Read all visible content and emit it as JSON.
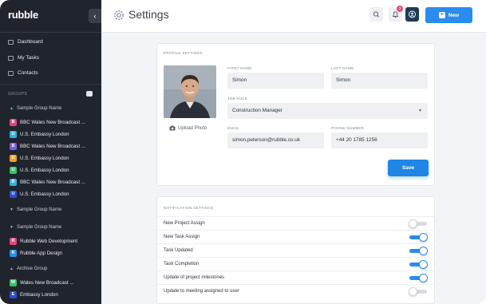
{
  "app": {
    "logo": "rubble",
    "collapse_glyph": "‹"
  },
  "nav": [
    {
      "label": "Dashboard"
    },
    {
      "label": "My Tasks"
    },
    {
      "label": "Contacts"
    }
  ],
  "groups": {
    "title": "GROUPS",
    "sections": [
      {
        "name": "Sample Group Name",
        "expanded": true,
        "items": [
          {
            "letter": "B",
            "color": "#e0457b",
            "label": "BBC Wales New Broadcast ..."
          },
          {
            "letter": "U",
            "color": "#2bb5e0",
            "label": "U.S. Embassy London"
          },
          {
            "letter": "B",
            "color": "#7b5be6",
            "label": "BBC Wales New Broadcast ..."
          },
          {
            "letter": "U",
            "color": "#f0a020",
            "label": "U.S. Embassy London"
          },
          {
            "letter": "U",
            "color": "#35c46a",
            "label": "U.S. Embassy London"
          },
          {
            "letter": "B",
            "color": "#2bb5e0",
            "label": "BBC Wales New Broadcast ..."
          },
          {
            "letter": "U",
            "color": "#2a4fd6",
            "label": "U.S. Embassy London"
          }
        ]
      },
      {
        "name": "Sample Group Name",
        "expanded": false,
        "items": []
      },
      {
        "name": "Sample Group Name",
        "expanded": false,
        "items": [
          {
            "letter": "R",
            "color": "#e0457b",
            "label": "Rubble Web Development"
          },
          {
            "letter": "R",
            "color": "#2a8cf0",
            "label": "Rubble App Design"
          }
        ]
      },
      {
        "name": "Archive Group",
        "expanded": true,
        "items": [
          {
            "letter": "W",
            "color": "#35c46a",
            "label": "Wales New Broadcast ..."
          },
          {
            "letter": "E",
            "color": "#2a4fd6",
            "label": "Embassy London"
          }
        ]
      }
    ]
  },
  "header": {
    "title": "Settings",
    "notifications_count": "3",
    "new_label": "New"
  },
  "profile": {
    "section_title": "PROFILE SETTINGS",
    "upload_label": "Upload Photo",
    "first_name_label": "FIRST NAME",
    "first_name": "Simon",
    "last_name_label": "LAST NAME",
    "last_name": "Simon",
    "job_role_label": "JOB ROLE",
    "job_role": "Construction Manager",
    "email_label": "EMAIL",
    "email": "simon.peterson@rubble.co.uk",
    "phone_label": "PHONE NUMBER",
    "phone": "+44 20 1785 1256",
    "save_label": "Save"
  },
  "notifications": {
    "section_title": "NOTIFICATION SETTINGS",
    "rows": [
      {
        "label": "New Project Assign",
        "on": false
      },
      {
        "label": "New Task Assign",
        "on": true
      },
      {
        "label": "Task Updated",
        "on": true
      },
      {
        "label": "Task Completion",
        "on": true
      },
      {
        "label": "Update of project milestones",
        "on": true
      },
      {
        "label": "Update to meeting assigned to user",
        "on": false
      }
    ]
  }
}
